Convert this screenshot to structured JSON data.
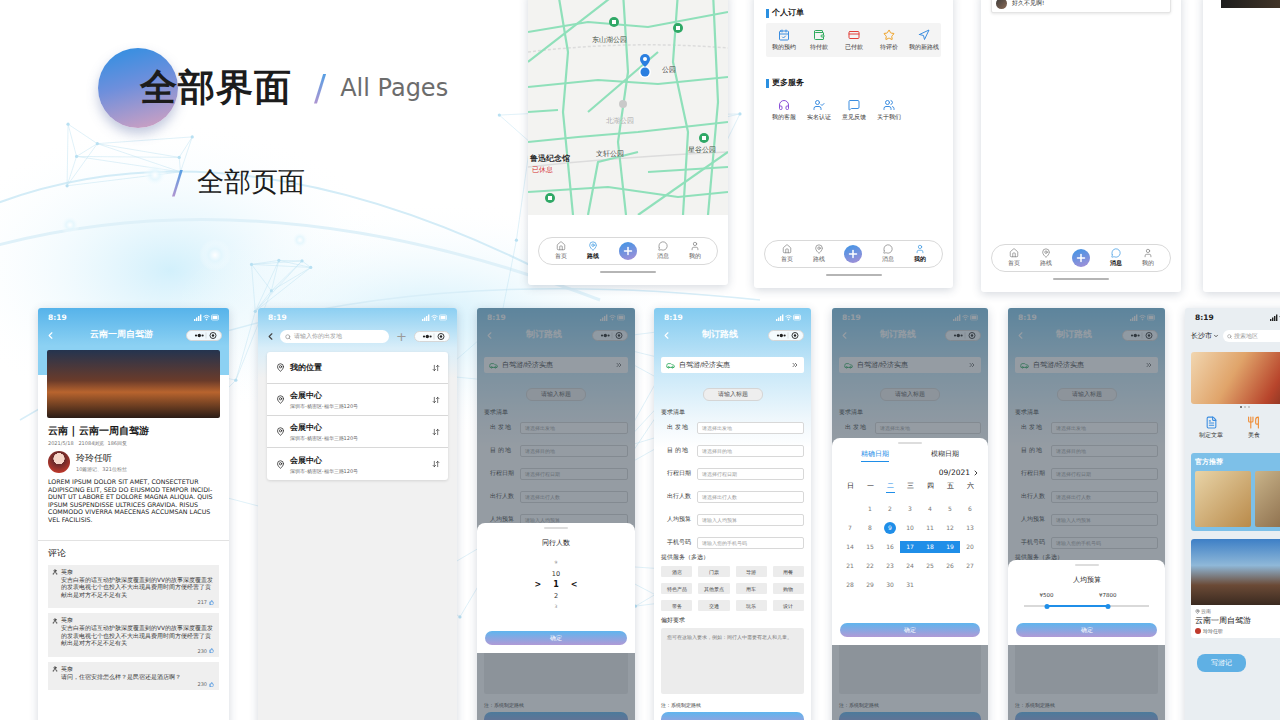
{
  "header": {
    "title": "全部界面",
    "divider": "/",
    "subtitle": "All Pages",
    "section_divider": "/",
    "section": "全部页面"
  },
  "map_screen": {
    "labels": [
      {
        "text": "东山湖公园",
        "kind": "park"
      },
      {
        "text": "公园",
        "kind": "place"
      },
      {
        "text": "北湖公园",
        "kind": "faded"
      },
      {
        "text": "文轩公园",
        "kind": "place"
      },
      {
        "text": "星谷公园",
        "kind": "park"
      },
      {
        "text": "鲁迅纪念馆",
        "kind": "museum"
      },
      {
        "text": "已休息",
        "kind": "closed"
      }
    ],
    "tabs": [
      {
        "label": "首页",
        "selected": false
      },
      {
        "label": "路线",
        "selected": true
      },
      {
        "label": "消息",
        "selected": false
      },
      {
        "label": "我的",
        "selected": false
      }
    ]
  },
  "profile_screen": {
    "orders_title": "个人订单",
    "orders": [
      {
        "label": "我的预约",
        "color": "#3b8de0"
      },
      {
        "label": "待付款",
        "color": "#2eaa5c"
      },
      {
        "label": "已付款",
        "color": "#e2403a"
      },
      {
        "label": "待评价",
        "color": "#f0a020"
      },
      {
        "label": "我的新路线",
        "color": "#3b8de0"
      }
    ],
    "services_title": "更多服务",
    "services": [
      {
        "label": "我的客服",
        "color": "#8a4fd8"
      },
      {
        "label": "实名认证",
        "color": "#3b8de0"
      },
      {
        "label": "意见反馈",
        "color": "#3b8de0"
      },
      {
        "label": "关于我们",
        "color": "#3b8de0"
      }
    ],
    "tabs": [
      {
        "label": "首页",
        "selected": false
      },
      {
        "label": "路线",
        "selected": false
      },
      {
        "label": "消息",
        "selected": false
      },
      {
        "label": "我的",
        "selected": true
      }
    ]
  },
  "messages_screen": {
    "preview": "好久不见啊!",
    "tabs": [
      {
        "label": "首页",
        "selected": false
      },
      {
        "label": "路线",
        "selected": false
      },
      {
        "label": "消息",
        "selected": true
      },
      {
        "label": "我的",
        "selected": false
      }
    ]
  },
  "detail_screen": {
    "time": "8:19",
    "title": "云南一周自驾游",
    "post_title": "云南 | 云南一周自驾游",
    "meta": "2021/5/18   21084浏览  186回复",
    "author": "玲玲任听",
    "author_meta": "10篇游记、321位粉丝",
    "body": "LOREM IPSUM DOLOR SIT AMET, CONSECTETUR ADIPISCING ELIT, SED DO EIUSMOD TEMPOR INCIDI-DUNT UT LABORE ET DOLORE MAGNA ALIQUA. QUIS IPSUM SUSPENDISSE ULTRICES GRAVIDA. RISUS COMMODO VIVERRA MAECENAS ACCUMSAN LACUS VEL FACILISIS.",
    "comments_title": "评论",
    "comments": [
      {
        "user": "英奈",
        "text": "安吉白茶的话互动护肤深度覆盖到的VV的故事深度覆盖发的发表电视七个也投入不大出现具费用时间方便经营了贡献出是对方不足不足有关",
        "likes": "217"
      },
      {
        "user": "英奈",
        "text": "安吉白茶的话互动护肤深度覆盖到的VV的故事深度覆盖发的发表电视七个也投入不大出现具费用时间方便经营了贡献出是对方不足不足有关",
        "likes": "230"
      },
      {
        "user": "英奈",
        "text": "请问，住宿安排怎么样？是民宿还是酒店啊？",
        "likes": "230"
      }
    ]
  },
  "search_screen": {
    "time": "8:19",
    "placeholder": "请输入你的出发地",
    "add": "+",
    "places": [
      {
        "name": "我的位置"
      },
      {
        "name": "会展中心",
        "address": "深圳市-杨宙区-福华三路120号"
      },
      {
        "name": "会展中心",
        "address": "深圳市-杨宙区-福华三路120号"
      },
      {
        "name": "会展中心",
        "address": "深圳市-杨宙区-福华三路120号"
      }
    ]
  },
  "route_form": {
    "time": "8:19",
    "title": "制订路线",
    "trip_type": "自驾游/经济实惠",
    "title_placeholder": "请输入标题",
    "requirements_title": "要求清单",
    "fields": [
      {
        "label": "出 发 地",
        "placeholder": "请选择出发地"
      },
      {
        "label": "目 的 地",
        "placeholder": "请选择目的地"
      },
      {
        "label": "行程日期",
        "placeholder": "请选择行程日期"
      },
      {
        "label": "出行人数",
        "placeholder": "请选择出行人数"
      },
      {
        "label": "人均预算",
        "placeholder": "请输入人均预算"
      },
      {
        "label": "手机号码",
        "placeholder": "请输入您的手机号码"
      }
    ],
    "services_title": "提供服务（多选）",
    "services": [
      "酒店",
      "门票",
      "导游",
      "用餐",
      "特色产品",
      "其他景点",
      "用车",
      "购物",
      "带务",
      "交通",
      "玩乐",
      "设计"
    ],
    "preference_title": "偏好要求",
    "preference_placeholder": "您可在这输入要求，例如：同行人中需要有老人和儿童。",
    "note": "注：系统制定路线"
  },
  "people_picker": {
    "title": "同行人数",
    "options": [
      {
        "label": "9",
        "selected": false
      },
      {
        "label": "10",
        "selected": false
      },
      {
        "label": "1",
        "selected": true
      },
      {
        "label": "2",
        "selected": false
      },
      {
        "label": "3",
        "selected": false
      }
    ],
    "left_mark": ">",
    "right_mark": "<",
    "confirm": "确定"
  },
  "date_picker": {
    "tabs": [
      {
        "label": "精确日期",
        "selected": true
      },
      {
        "label": "模糊日期",
        "selected": false
      }
    ],
    "month": "09/2021",
    "weekdays": [
      {
        "label": "日",
        "selected": false
      },
      {
        "label": "一",
        "selected": false
      },
      {
        "label": "二",
        "selected": true
      },
      {
        "label": "三",
        "selected": false
      },
      {
        "label": "四",
        "selected": false
      },
      {
        "label": "五",
        "selected": false
      },
      {
        "label": "六",
        "selected": false
      }
    ],
    "days": [
      {
        "label": "1",
        "selected": false,
        "in_range": false
      },
      {
        "label": "2",
        "selected": false,
        "in_range": false
      },
      {
        "label": "3",
        "selected": false,
        "in_range": false
      },
      {
        "label": "4",
        "selected": false,
        "in_range": false
      },
      {
        "label": "5",
        "selected": false,
        "in_range": false
      },
      {
        "label": "6",
        "selected": false,
        "in_range": false
      },
      {
        "label": "7",
        "selected": false,
        "in_range": false
      },
      {
        "label": "8",
        "selected": false,
        "in_range": false
      },
      {
        "label": "9",
        "selected": true,
        "in_range": false
      },
      {
        "label": "10",
        "selected": false,
        "in_range": false
      },
      {
        "label": "11",
        "selected": false,
        "in_range": false
      },
      {
        "label": "12",
        "selected": false,
        "in_range": false
      },
      {
        "label": "13",
        "selected": false,
        "in_range": false
      },
      {
        "label": "14",
        "selected": false,
        "in_range": false
      },
      {
        "label": "15",
        "selected": false,
        "in_range": false
      },
      {
        "label": "16",
        "selected": false,
        "in_range": false
      },
      {
        "label": "17",
        "selected": false,
        "in_range": true
      },
      {
        "label": "18",
        "selected": false,
        "in_range": true
      },
      {
        "label": "19",
        "selected": false,
        "in_range": true
      },
      {
        "label": "20",
        "selected": false,
        "in_range": false
      },
      {
        "label": "21",
        "selected": false,
        "in_range": false
      },
      {
        "label": "22",
        "selected": false,
        "in_range": false
      },
      {
        "label": "23",
        "selected": false,
        "in_range": false
      },
      {
        "label": "24",
        "selected": false,
        "in_range": false
      },
      {
        "label": "25",
        "selected": false,
        "in_range": false
      },
      {
        "label": "26",
        "selected": false,
        "in_range": false
      },
      {
        "label": "27",
        "selected": false,
        "in_range": false
      },
      {
        "label": "28",
        "selected": false,
        "in_range": false
      },
      {
        "label": "29",
        "selected": false,
        "in_range": false
      },
      {
        "label": "30",
        "selected": false,
        "in_range": false
      },
      {
        "label": "31",
        "selected": false,
        "in_range": false
      }
    ],
    "confirm": "确定"
  },
  "budget_picker": {
    "title": "人均预算",
    "low": "¥500",
    "high": "¥7800",
    "level_low": 0.18,
    "level_high": 0.67,
    "confirm": "确定"
  },
  "home_screen": {
    "time": "8:19",
    "city": "长沙市",
    "search_placeholder": "搜索地区",
    "shortcuts": [
      {
        "label": "制定文章",
        "color": "#3b8de0"
      },
      {
        "label": "美食",
        "color": "#f08a30"
      }
    ],
    "recommend_title": "官方推荐",
    "card": {
      "region": "云南",
      "title": "云南一周自驾游",
      "author": "玲玲任听"
    },
    "write_button": "写游记"
  }
}
